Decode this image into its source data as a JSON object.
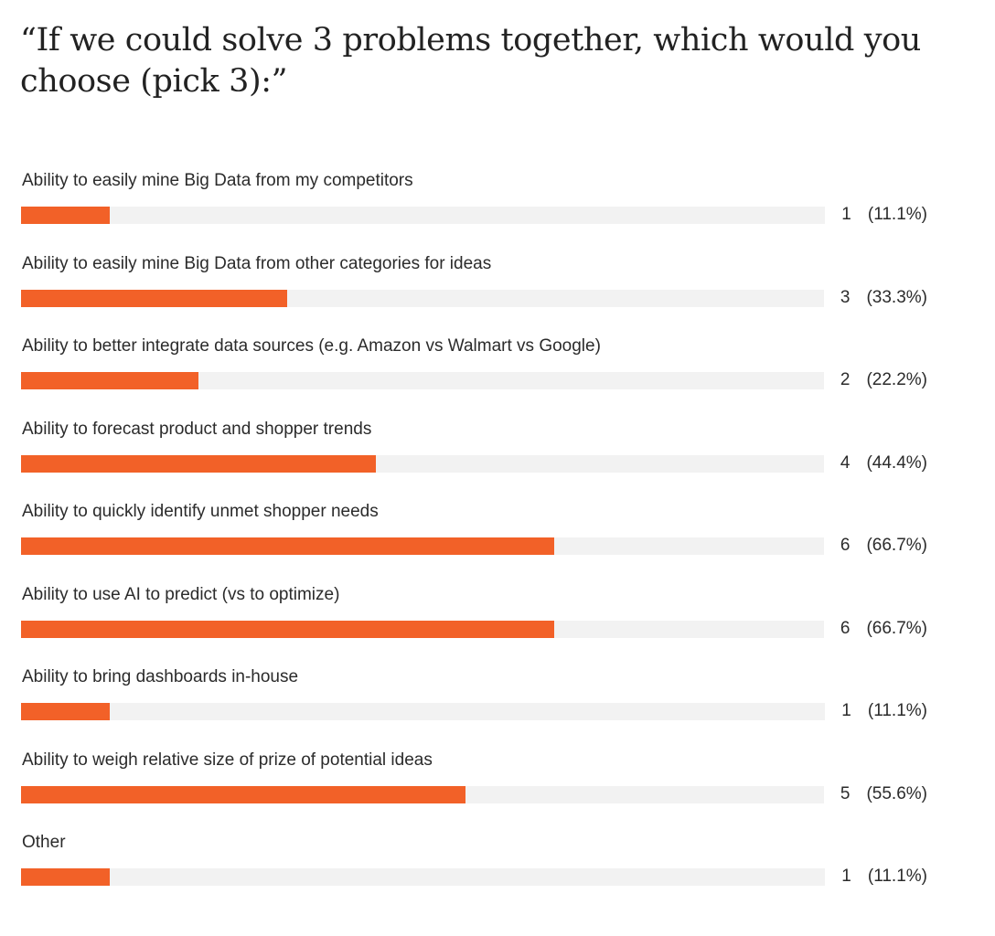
{
  "chart_data": {
    "type": "bar",
    "orientation": "horizontal",
    "title": "“If we could solve 3 problems together, which would you choose (pick 3):”",
    "categories": [
      "Ability to easily mine Big Data from my competitors",
      "Ability to easily mine Big Data from other categories for ideas",
      "Ability to better integrate data sources (e.g. Amazon vs Walmart vs Google)",
      "Ability to forecast product and shopper trends",
      "Ability to quickly identify unmet shopper needs",
      "Ability to use AI to predict (vs to optimize)",
      "Ability to bring dashboards in-house",
      "Ability to weigh relative size of prize of potential ideas",
      "Other"
    ],
    "values": [
      1,
      3,
      2,
      4,
      6,
      6,
      1,
      5,
      1
    ],
    "percent_labels": [
      "(11.1%)",
      "(33.3%)",
      "(22.2%)",
      "(44.4%)",
      "(66.7%)",
      "(66.7%)",
      "(11.1%)",
      "(55.6%)",
      "(11.1%)"
    ],
    "percents": [
      11.1,
      33.3,
      22.2,
      44.4,
      66.7,
      66.7,
      11.1,
      55.6,
      11.1
    ],
    "xlim": [
      0,
      9
    ],
    "grid": false,
    "legend": "none",
    "colors": {
      "bar": "#f26128",
      "track": "#f2f2f2",
      "text": "#2b2b2b"
    }
  }
}
